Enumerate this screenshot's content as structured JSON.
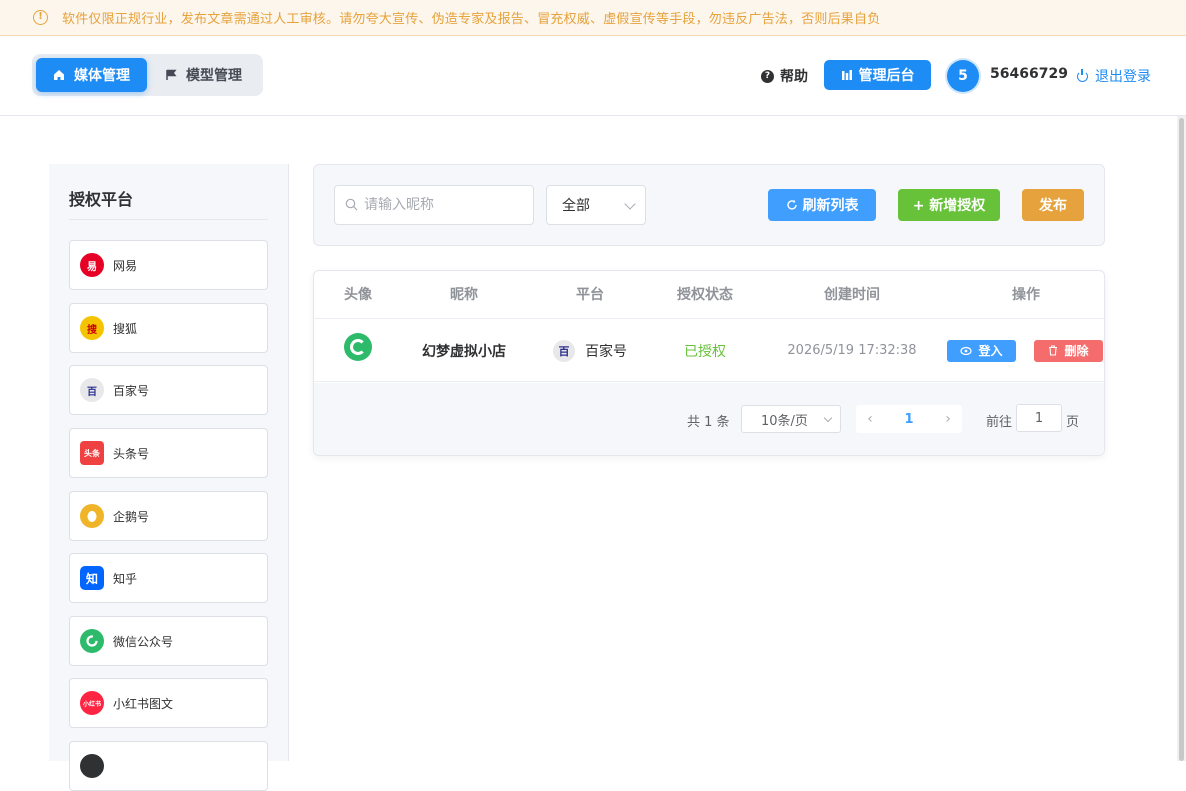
{
  "notice": {
    "text": "软件仅限正规行业，发布文章需通过人工审核。请勿夸大宣传、伪造专家及报告、冒充权威、虚假宣传等手段，勿违反广告法，否则后果自负"
  },
  "header": {
    "tabs": [
      {
        "label": "媒体管理",
        "active": true
      },
      {
        "label": "模型管理",
        "active": false
      }
    ],
    "help_label": "帮助",
    "admin_label": "管理后台",
    "avatar_text": "5",
    "user_id": "56466729",
    "logout_label": "退出登录"
  },
  "sidebar": {
    "title": "授权平台",
    "items": [
      {
        "label": "网易",
        "icon": "netease-icon",
        "color": "#e60026",
        "glyph": "易"
      },
      {
        "label": "搜狐",
        "icon": "sohu-icon",
        "color": "#f5c400",
        "glyph": "搜"
      },
      {
        "label": "百家号",
        "icon": "baijiahao-icon",
        "color": "#e8e8ea",
        "glyph": "百"
      },
      {
        "label": "头条号",
        "icon": "toutiao-icon",
        "color": "#f04142",
        "glyph": "头条"
      },
      {
        "label": "企鹅号",
        "icon": "penguin-icon",
        "color": "#f0b429",
        "glyph": ""
      },
      {
        "label": "知乎",
        "icon": "zhihu-icon",
        "color": "#0066ff",
        "glyph": "知"
      },
      {
        "label": "微信公众号",
        "icon": "wechat-icon",
        "color": "#2dbb6b",
        "glyph": ""
      },
      {
        "label": "小红书图文",
        "icon": "xiaohongshu-icon",
        "color": "#ff2442",
        "glyph": "小红书"
      },
      {
        "label": "",
        "icon": "tiktok-icon",
        "color": "#303133",
        "glyph": ""
      }
    ]
  },
  "filter": {
    "search_placeholder": "请输入昵称",
    "select_value": "全部",
    "refresh_label": "刷新列表",
    "add_label": "+ 新增授权",
    "publish_label": "发布"
  },
  "table": {
    "headers": [
      "头像",
      "昵称",
      "平台",
      "授权状态",
      "创建时间",
      "操作"
    ],
    "rows": [
      {
        "nickname": "幻梦虚拟小店",
        "platform": "百家号",
        "status": "已授权",
        "created": "2026/5/19 17:32:38",
        "login_label": "登入",
        "delete_label": "删除"
      }
    ]
  },
  "pagination": {
    "total": "共 1 条",
    "page_size": "10条/页",
    "current_page": "1",
    "goto_label": "前往",
    "goto_value": "1",
    "goto_suffix": "页"
  },
  "colors": {
    "primary": "#1e8cf5",
    "success": "#67c23a",
    "warning": "#e6a23c",
    "danger": "#f56c6c"
  }
}
